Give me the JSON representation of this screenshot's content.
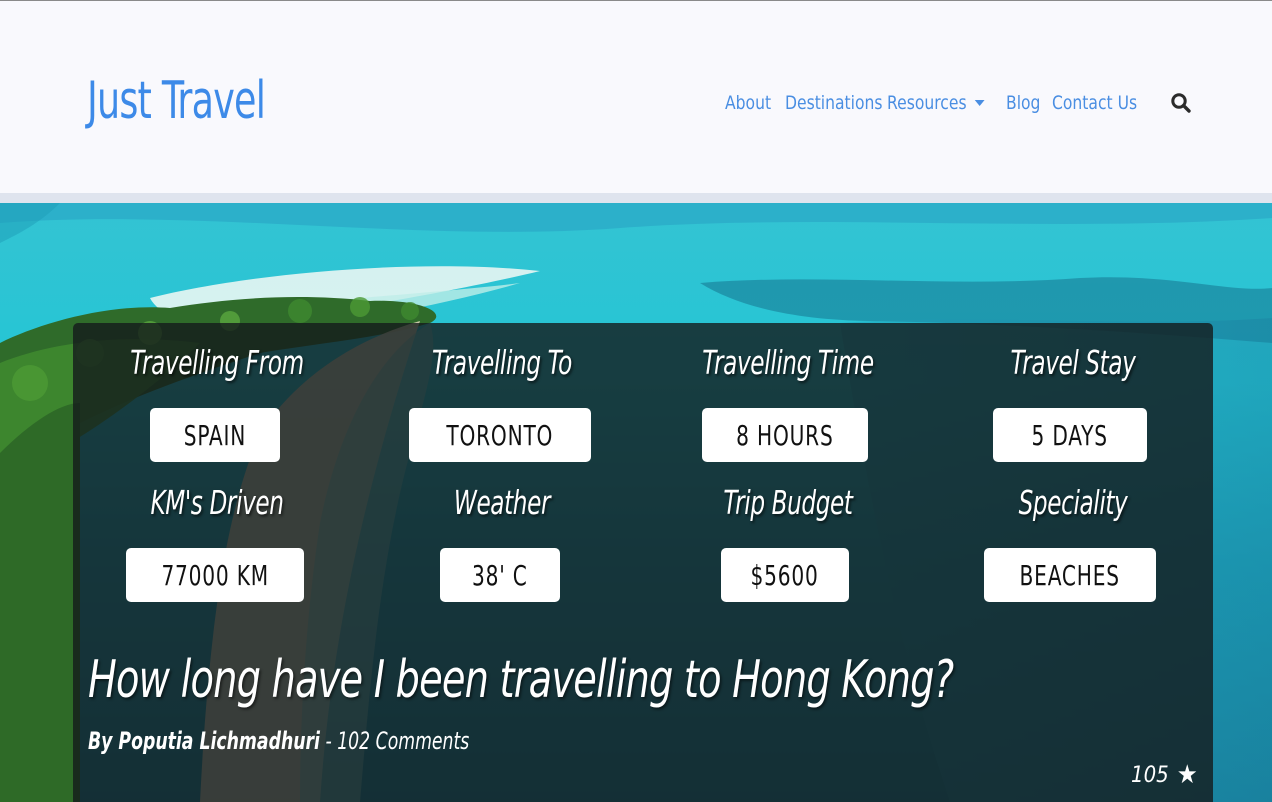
{
  "brand": "Just Travel",
  "nav": {
    "items": [
      {
        "label": "About"
      },
      {
        "label": "Destinations"
      },
      {
        "label": "Resources"
      },
      {
        "label": "Blog"
      },
      {
        "label": "Contact Us"
      }
    ],
    "search_icon": "search-icon",
    "dropdown_icon": "chevron-down-icon"
  },
  "stats": [
    {
      "label": "Travelling From",
      "value": "SPAIN"
    },
    {
      "label": "Travelling To",
      "value": "TORONTO"
    },
    {
      "label": "Travelling Time",
      "value": "8 HOURS"
    },
    {
      "label": "Travel Stay",
      "value": "5 DAYS"
    },
    {
      "label": "KM's Driven",
      "value": "77000 KM"
    },
    {
      "label": "Weather",
      "value": "38' C"
    },
    {
      "label": "Trip Budget",
      "value": "$5600"
    },
    {
      "label": "Speciality",
      "value": "BEACHES"
    }
  ],
  "post": {
    "title": "How long have I been travelling to Hong Kong?",
    "author": "By Poputia Lichmadhuri",
    "separator": " - ",
    "comments": "102 Comments",
    "rating_count": "105",
    "rating_icon": "star-icon"
  },
  "colors": {
    "brand": "#3d8ae8",
    "nav_link": "#4a8ee2",
    "header_bg": "#f9f9fd",
    "card_overlay": "rgba(20,26,28,0.80)"
  }
}
